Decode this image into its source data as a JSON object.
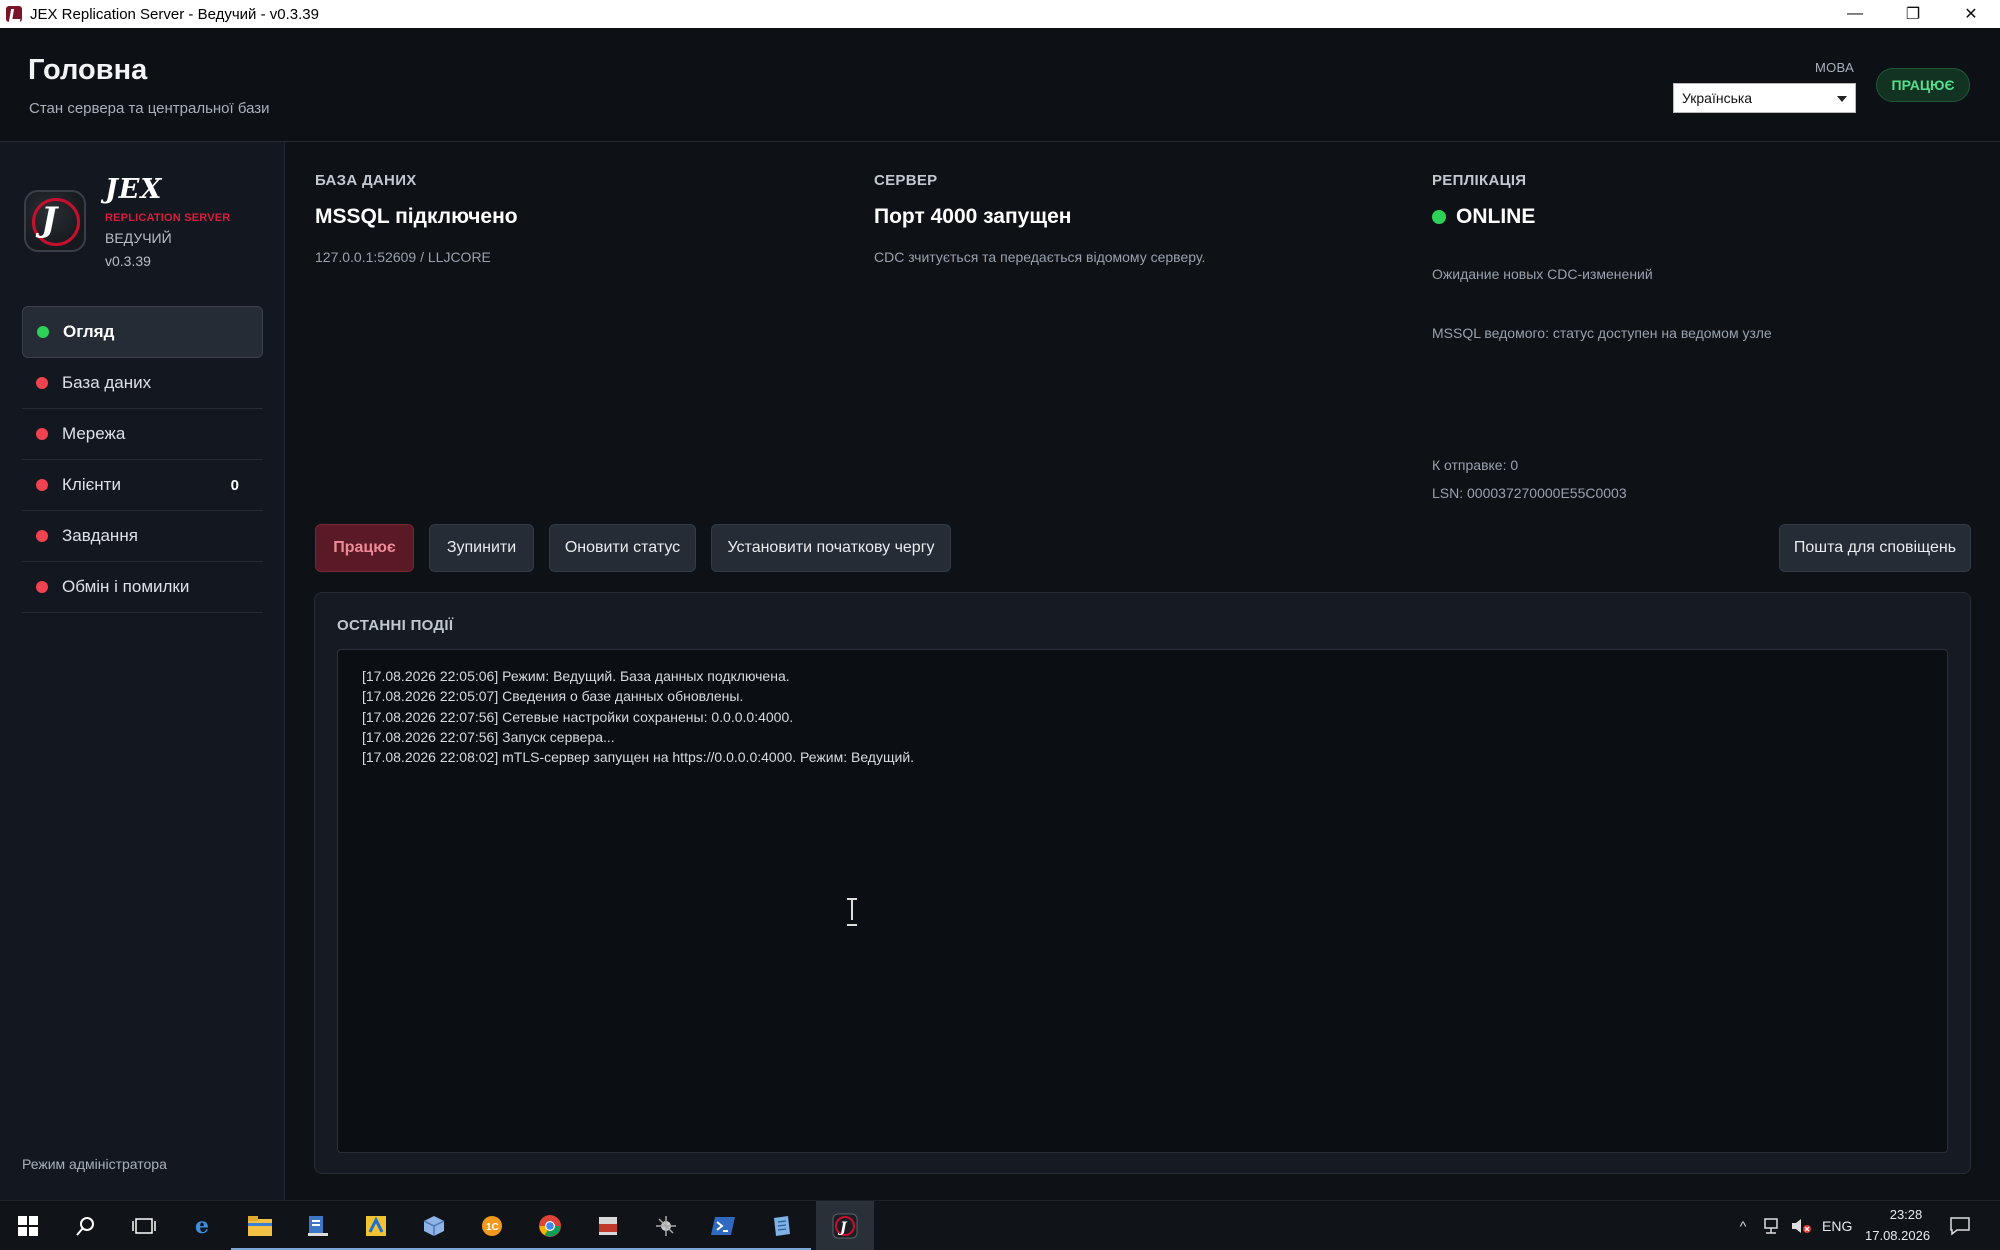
{
  "window": {
    "title": "JEX Replication Server - Ведучий - v0.3.39",
    "minimize": "—",
    "maximize": "❐",
    "close": "✕"
  },
  "header": {
    "title": "Головна",
    "subtitle": "Стан сервера та центральної бази",
    "language_label": "МОВА",
    "language_value": "Українська",
    "status": "ПРАЦЮЄ"
  },
  "sidebar": {
    "brand": "JEX",
    "brand_sub": "REPLICATION SERVER",
    "role": "ВЕДУЧИЙ",
    "version": "v0.3.39",
    "items": [
      {
        "label": "Огляд",
        "status_color": "#2ed158",
        "count": ""
      },
      {
        "label": "База даних",
        "status_color": "#f0424f",
        "count": ""
      },
      {
        "label": "Мережа",
        "status_color": "#f0424f",
        "count": ""
      },
      {
        "label": "Клієнти",
        "status_color": "#f0424f",
        "count": "0"
      },
      {
        "label": "Завдання",
        "status_color": "#f0424f",
        "count": ""
      },
      {
        "label": "Обмін і помилки",
        "status_color": "#f0424f",
        "count": ""
      }
    ],
    "admin_mode": "Режим адміністратора"
  },
  "cards": {
    "database": {
      "label": "БАЗА ДАНИХ",
      "value": "MSSQL підключено",
      "note": "127.0.0.1:52609 / LLJCORE"
    },
    "server": {
      "label": "СЕРВЕР",
      "value": "Порт 4000 запущен",
      "note": "CDC зчитується та передається відомому серверу."
    },
    "replication": {
      "label": "РЕПЛІКАЦІЯ",
      "value": "ONLINE",
      "note1": "Ожидание новых CDC-изменений",
      "note2": "MSSQL ведомого: статус доступен на ведомом узле",
      "pending": "К отправке: 0",
      "lsn": "LSN: 000037270000E55C0003"
    }
  },
  "actions": {
    "running": "Працює",
    "stop": "Зупинити",
    "refresh": "Оновити статус",
    "set_queue": "Установити початкову чергу",
    "email": "Пошта для сповіщень"
  },
  "events": {
    "title": "ОСТАННІ ПОДІЇ",
    "lines": [
      "[17.08.2026 22:05:06] Режим: Ведущий. База данных подключена.",
      "[17.08.2026 22:05:07] Сведения о базе данных обновлены.",
      "[17.08.2026 22:07:56] Сетевые настройки сохранены: 0.0.0.0:4000.",
      "[17.08.2026 22:07:56] Запуск сервера...",
      "[17.08.2026 22:08:02] mTLS-сервер запущен на https://0.0.0.0:4000. Режим: Ведущий."
    ]
  },
  "taskbar": {
    "lang": "ENG",
    "time": "23:28",
    "date": "17.08.2026"
  },
  "colors": {
    "accent_red": "#d81e3c",
    "ok_green": "#2ed158",
    "error_red": "#f0424f"
  }
}
